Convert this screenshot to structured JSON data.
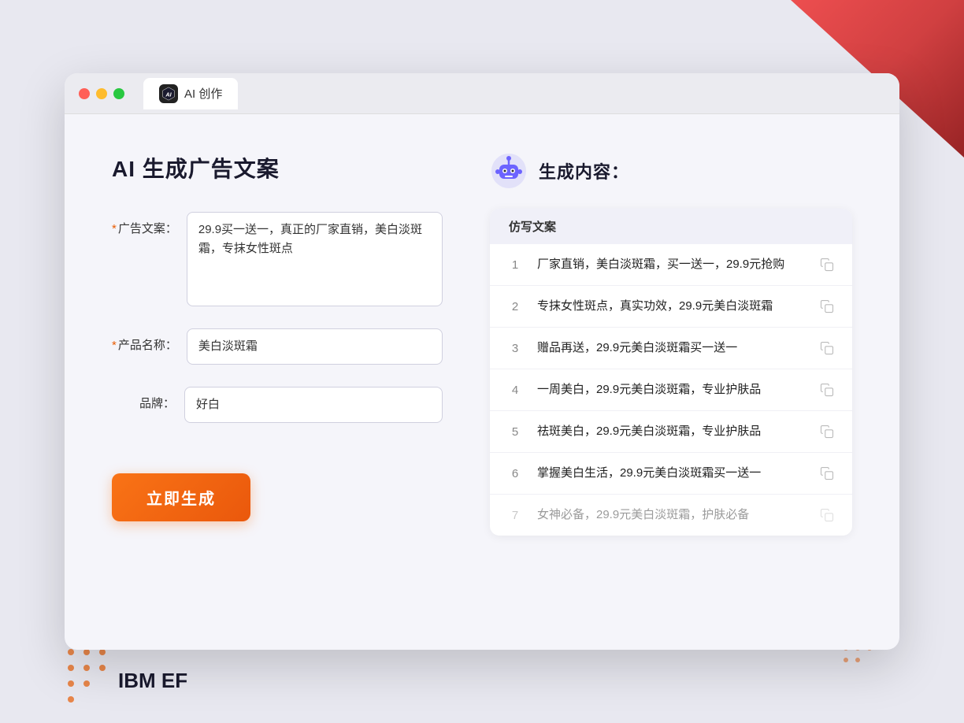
{
  "window": {
    "tab_label": "AI 创作"
  },
  "left_panel": {
    "title": "AI 生成广告文案",
    "fields": [
      {
        "id": "ad-copy",
        "label": "广告文案：",
        "required": true,
        "type": "textarea",
        "value": "29.9买一送一，真正的厂家直销，美白淡斑霜，专抹女性斑点"
      },
      {
        "id": "product-name",
        "label": "产品名称：",
        "required": true,
        "type": "input",
        "value": "美白淡斑霜"
      },
      {
        "id": "brand",
        "label": "品牌：",
        "required": false,
        "type": "input",
        "value": "好白"
      }
    ],
    "generate_button": "立即生成"
  },
  "right_panel": {
    "title": "生成内容：",
    "column_header": "仿写文案",
    "results": [
      {
        "num": "1",
        "text": "厂家直销，美白淡斑霜，买一送一，29.9元抢购",
        "faded": false
      },
      {
        "num": "2",
        "text": "专抹女性斑点，真实功效，29.9元美白淡斑霜",
        "faded": false
      },
      {
        "num": "3",
        "text": "赠品再送，29.9元美白淡斑霜买一送一",
        "faded": false
      },
      {
        "num": "4",
        "text": "一周美白，29.9元美白淡斑霜，专业护肤品",
        "faded": false
      },
      {
        "num": "5",
        "text": "祛斑美白，29.9元美白淡斑霜，专业护肤品",
        "faded": false
      },
      {
        "num": "6",
        "text": "掌握美白生活，29.9元美白淡斑霜买一送一",
        "faded": false
      },
      {
        "num": "7",
        "text": "女神必备，29.9元美白淡斑霜，护肤必备",
        "faded": true
      }
    ]
  },
  "colors": {
    "accent_orange": "#f97316",
    "accent_purple": "#7c6ff7",
    "required_star": "#e85d04"
  }
}
